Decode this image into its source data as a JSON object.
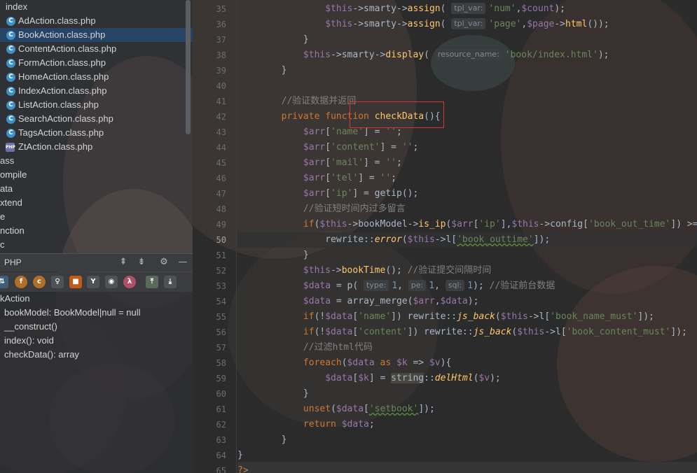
{
  "project_tree": {
    "items": [
      {
        "label": "index",
        "type": "folder",
        "selected": false
      },
      {
        "label": "AdAction.class.php",
        "type": "class",
        "selected": false
      },
      {
        "label": "BookAction.class.php",
        "type": "class",
        "selected": true
      },
      {
        "label": "ContentAction.class.php",
        "type": "class",
        "selected": false
      },
      {
        "label": "FormAction.class.php",
        "type": "class",
        "selected": false
      },
      {
        "label": "HomeAction.class.php",
        "type": "class",
        "selected": false
      },
      {
        "label": "IndexAction.class.php",
        "type": "class",
        "selected": false
      },
      {
        "label": "ListAction.class.php",
        "type": "class",
        "selected": false
      },
      {
        "label": "SearchAction.class.php",
        "type": "class",
        "selected": false
      },
      {
        "label": "TagsAction.class.php",
        "type": "class",
        "selected": false
      },
      {
        "label": "ZtAction.class.php",
        "type": "php",
        "selected": false
      },
      {
        "label": "ass",
        "type": "folder",
        "selected": false
      },
      {
        "label": "ompile",
        "type": "folder",
        "selected": false
      },
      {
        "label": "ata",
        "type": "folder",
        "selected": false
      },
      {
        "label": "xtend",
        "type": "folder",
        "selected": false
      },
      {
        "label": "e",
        "type": "folder",
        "selected": false
      },
      {
        "label": "nction",
        "type": "folder",
        "selected": false
      },
      {
        "label": "c",
        "type": "folder",
        "selected": false
      }
    ]
  },
  "structure_panel": {
    "title": "PHP",
    "class_name": "kAction",
    "members": [
      {
        "label": "bookModel: BookModel|null = null"
      },
      {
        "label": "__construct()"
      },
      {
        "label": "index(): void"
      },
      {
        "label": "checkData(): array"
      }
    ],
    "toolbar_icons": [
      "sort-icon",
      "field-icon",
      "constant-icon",
      "property-icon",
      "lock-icon",
      "inheritance-icon",
      "circle-icon",
      "lambda-icon",
      "expand-icon",
      "collapse-icon"
    ]
  },
  "editor": {
    "current_line": 50,
    "line_numbers": [
      "35",
      "36",
      "37",
      "38",
      "39",
      "40",
      "41",
      "42",
      "43",
      "44",
      "45",
      "46",
      "47",
      "48",
      "49",
      "50",
      "51",
      "52",
      "53",
      "54",
      "55",
      "56",
      "57",
      "58",
      "59",
      "60",
      "61",
      "62",
      "63",
      "64",
      "65"
    ],
    "highlighted_function": "checkData",
    "colors": {
      "keyword": "#cc7832",
      "variable": "#9876aa",
      "string": "#6a8759",
      "number": "#6897bb",
      "function": "#ffc66d",
      "comment": "#808080",
      "highlight_box": "#d33a36"
    },
    "lines": {
      "l35_a": "$this",
      "l35_b": "->smarty->",
      "l35_c": "assign",
      "l35_hint": "tpl_var:",
      "l35_str": "'num'",
      "l35_d": ",",
      "l35_var": "$count",
      "l35_e": ");",
      "l36_a": "$this",
      "l36_b": "->smarty->",
      "l36_c": "assign",
      "l36_hint": "tpl_var:",
      "l36_str": "'page'",
      "l36_d": ",",
      "l36_var": "$page",
      "l36_e": "->",
      "l36_f": "html",
      "l36_g": "());",
      "l37": "}",
      "l38_a": "$this",
      "l38_b": "->smarty->",
      "l38_c": "display",
      "l38_hint": "resource_name:",
      "l38_str": "'book/index.html'",
      "l38_e": ");",
      "l39": "}",
      "l41": "//验证数据并返回",
      "l42_kw": "private function ",
      "l42_fn": "checkData",
      "l42_e": "(){",
      "l43_var": "$arr",
      "l43_b": "[",
      "l43_str": "'name'",
      "l43_c": "] = ",
      "l43_str2": "''",
      "l43_e": ";",
      "l44_var": "$arr",
      "l44_str": "'content'",
      "l44_str2": "''",
      "l45_var": "$arr",
      "l45_str": "'mail'",
      "l45_str2": "''",
      "l46_var": "$arr",
      "l46_str": "'tel'",
      "l46_str2": "''",
      "l47_var": "$arr",
      "l47_str": "'ip'",
      "l47_c": "] = getip();",
      "l48": "//验证短时间内过多留言",
      "l49_kw": "if",
      "l49_a": "(",
      "l49_this": "$this",
      "l49_b": "->bookModel->",
      "l49_fn": "is_ip",
      "l49_var": "$arr",
      "l49_str": "'ip'",
      "l49_this2": "$this",
      "l49_c": "->config[",
      "l49_str2": "'book_out_time'",
      "l49_d": "]) >= $",
      "l50_a": "rewrite::",
      "l50_fn": "error",
      "l50_this": "$this",
      "l50_b": "->l[",
      "l50_str": "'book_outtime'",
      "l50_e": "]);",
      "l51": "}",
      "l52_this": "$this",
      "l52_b": "->",
      "l52_fn": "bookTime",
      "l52_c": "(); ",
      "l52_cmt": "//验证提交间隔时间",
      "l53_var": "$data",
      "l53_b": " = p( ",
      "l53_h1": "type:",
      "l53_n1": "1",
      "l53_h2": "pe:",
      "l53_n2": "1",
      "l53_h3": "sql:",
      "l53_n3": "1",
      "l53_c": "); ",
      "l53_cmt": "//验证前台数据",
      "l54_var": "$data",
      "l54_b": " = array_merge(",
      "l54_var2": "$arr",
      "l54_var3": "$data",
      "l54_c": ");",
      "l55_kw": "if",
      "l55_var": "$data",
      "l55_str": "'name'",
      "l55_b": "]) rewrite::",
      "l55_fn": "js_back",
      "l55_this": "$this",
      "l55_str2": "'book_name_must'",
      "l56_kw": "if",
      "l56_var": "$data",
      "l56_str": "'content'",
      "l56_b": "]) rewrite::",
      "l56_fn": "js_back",
      "l56_this": "$this",
      "l56_str2": "'book_content_must'",
      "l57": "//过滤html代码",
      "l58_kw": "foreach",
      "l58_var": "$data",
      "l58_as": " as ",
      "l58_k": "$k",
      "l58_v": "$v",
      "l59_var": "$data",
      "l59_k": "$k",
      "l59_cls": "string",
      "l59_fn": "delHtml",
      "l59_v": "$v",
      "l60": "}",
      "l61_kw": "unset",
      "l61_var": "$data",
      "l61_str": "'setbook'",
      "l62_kw": "return ",
      "l62_var": "$data",
      "l63": "}",
      "l64": "}",
      "l65": "?>"
    }
  }
}
